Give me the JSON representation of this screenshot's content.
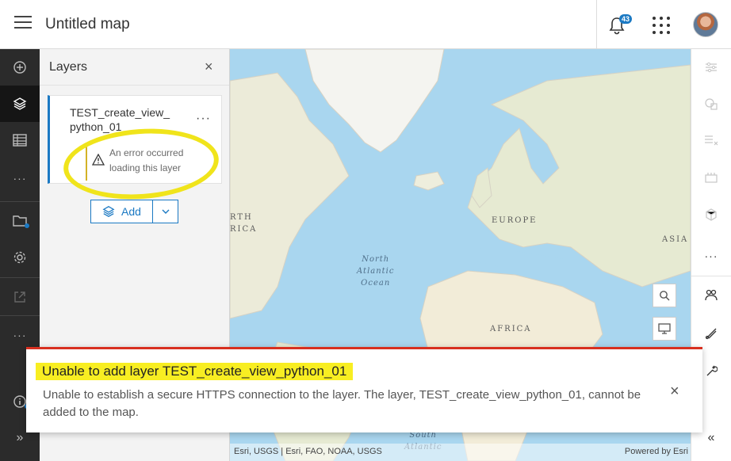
{
  "header": {
    "title": "Untitled map",
    "notification_count": "43"
  },
  "left_toolbar": {
    "items": [
      {
        "icon": "add-circle-icon",
        "glyph": "⊕"
      },
      {
        "icon": "layers-icon",
        "glyph": "❖"
      },
      {
        "icon": "table-icon",
        "glyph": "▦"
      },
      {
        "icon": "more-icon",
        "glyph": "···"
      },
      {
        "icon": "map-folder-icon",
        "glyph": "🗀"
      },
      {
        "icon": "settings-icon",
        "glyph": "⚙"
      },
      {
        "icon": "share-icon",
        "glyph": "⇱"
      },
      {
        "icon": "more-icon",
        "glyph": "···"
      },
      {
        "icon": "info-icon",
        "glyph": "ⓘ"
      },
      {
        "icon": "expand-icon",
        "glyph": "»"
      }
    ]
  },
  "layers_panel": {
    "title": "Layers",
    "close_glyph": "×",
    "layer": {
      "name": "TEST_create_view_python_01",
      "more_glyph": "···",
      "error_text": "An error occurred loading this layer"
    },
    "add_label": "Add"
  },
  "map": {
    "labels": {
      "north_america_1": "RTH",
      "north_america_2": "RICA",
      "europe": "EUROPE",
      "asia": "ASIA",
      "africa": "AFRICA",
      "north_atlantic": "North\nAtlantic\nOcean",
      "south_atlantic": "South\nAtlantic"
    },
    "attribution_left": "Esri, USGS | Esri, FAO, NOAA, USGS",
    "attribution_right": "Powered by Esri"
  },
  "right_toolbar": {
    "items": [
      "filter-icon",
      "styles-icon",
      "fields-icon",
      "analysis-icon",
      "3d-icon",
      "more-icon",
      "sketch-icon",
      "measure-icon",
      "tools-icon"
    ],
    "collapse_glyph": "«"
  },
  "alert": {
    "title": "Unable to add layer TEST_create_view_python_01",
    "message": "Unable to establish a secure HTTPS connection to the layer. The layer, TEST_create_view_python_01, cannot be added to the map.",
    "close_glyph": "×"
  },
  "colors": {
    "accent": "#1b79c3",
    "error": "#d83020",
    "highlight": "#f8ee22",
    "toolbar_dark": "#2b2b2b",
    "ocean": "#a9d6ef",
    "land": "#f2efe6"
  }
}
